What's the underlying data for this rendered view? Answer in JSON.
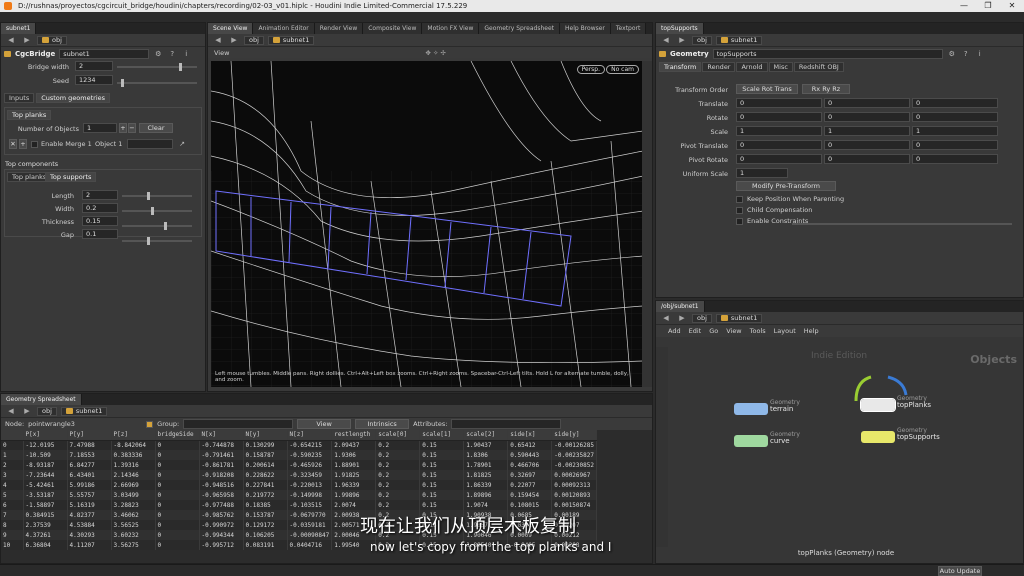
{
  "window": {
    "title": "D://rushnas/proyectos/cgcircuit_bridge/houdini/chapters/recording/02-03_v01.hiplc - Houdini Indie Limited-Commercial 17.5.229",
    "controls": [
      "—",
      "❐",
      "✕"
    ]
  },
  "left_panel": {
    "tab": "subnet1",
    "path": "obj",
    "node_type": "CgcBridge",
    "node_name": "subnet1",
    "params": [
      {
        "label": "Bridge width",
        "value": "2",
        "level": 0.78
      },
      {
        "label": "Seed",
        "value": "1234",
        "level": 0.05
      }
    ],
    "tabs": [
      "Inputs",
      "Custom geometries"
    ],
    "group_tab": "Top planks",
    "num_objects_label": "Number of Objects",
    "num_objects_value": "1",
    "plus": "+",
    "minus": "−",
    "clear_label": "Clear",
    "enable_merge_label": "Enable Merge 1",
    "object1_label": "Object 1",
    "top_components": "Top components",
    "comp_tabs": [
      "Top planks",
      "Top supports"
    ],
    "comp_params": [
      {
        "label": "Length",
        "value": "2",
        "level": 0.35
      },
      {
        "label": "Width",
        "value": "0.2",
        "level": 0.42
      },
      {
        "label": "Thickness",
        "value": "0.15",
        "level": 0.6
      },
      {
        "label": "Gap",
        "value": "0.1",
        "level": 0.35
      }
    ]
  },
  "center_tabs": [
    "Scene View",
    "Animation Editor",
    "Render View",
    "Composite View",
    "Motion FX View",
    "Geometry Spreadsheet",
    "Help Browser",
    "Textport"
  ],
  "viewport": {
    "path": "obj",
    "crumb": "subnet1",
    "label": "View",
    "persp": "Persp.",
    "cam": "No cam",
    "status": "Left mouse tumbles. Middle pans. Right dollies. Ctrl+Alt+Left box zooms. Ctrl+Right zooms. Spacebar-Ctrl-Left tilts. Hold L for alternate tumble, dolly, and zoom."
  },
  "params_panel": {
    "tab": "topSupports",
    "path": "obj",
    "crumb": "subnet1",
    "node_type": "Geometry",
    "node_name": "topSupports",
    "tabs": [
      "Transform",
      "Render",
      "Arnold",
      "Misc",
      "Redshift OBJ"
    ],
    "transform_order_label": "Transform Order",
    "transform_order": "Scale Rot Trans",
    "rot_order": "Rx Ry Rz",
    "rows": [
      {
        "label": "Translate",
        "v": [
          "0",
          "0",
          "0"
        ]
      },
      {
        "label": "Rotate",
        "v": [
          "0",
          "0",
          "0"
        ]
      },
      {
        "label": "Scale",
        "v": [
          "1",
          "1",
          "1"
        ]
      },
      {
        "label": "Pivot Translate",
        "v": [
          "0",
          "0",
          "0"
        ]
      },
      {
        "label": "Pivot Rotate",
        "v": [
          "0",
          "0",
          "0"
        ]
      }
    ],
    "uniform_scale_label": "Uniform Scale",
    "uniform_scale": "1",
    "modify_pre": "Modify Pre-Transform",
    "checks": [
      "Keep Position When Parenting",
      "Child Compensation",
      "Enable Constraints"
    ]
  },
  "network": {
    "tab": "/obj/subnet1",
    "path": "obj",
    "crumb": "subnet1",
    "menu": [
      "Add",
      "Edit",
      "Go",
      "View",
      "Tools",
      "Layout",
      "Help"
    ],
    "watermark": "Indie Edition",
    "context": "Objects",
    "nodes": [
      {
        "type": "Geometry",
        "name": "terrain",
        "color": "#8fb8e8"
      },
      {
        "type": "Geometry",
        "name": "topPlanks",
        "color": "#e8e8e8"
      },
      {
        "type": "Geometry",
        "name": "curve",
        "color": "#9fd89f"
      },
      {
        "type": "Geometry",
        "name": "topSupports",
        "color": "#e8e86a"
      }
    ],
    "footer": "topPlanks (Geometry) node"
  },
  "spreadsheet": {
    "tab": "Geometry Spreadsheet",
    "path": "obj",
    "crumb": "subnet1",
    "node_label": "Node:",
    "node": "pointwrangle3",
    "group_label": "Group:",
    "view": "View",
    "intrinsics": "Intrinsics",
    "attributes": "Attributes:",
    "columns": [
      "",
      "P[x]",
      "P[y]",
      "P[z]",
      "bridgeSide",
      "N[x]",
      "N[y]",
      "N[z]",
      "restlength",
      "scale[0]",
      "scale[1]",
      "scale[2]",
      "side[x]",
      "side[y]"
    ],
    "rows": [
      [
        "0",
        "-12.0195",
        "7.47988",
        "-8.842064",
        "0",
        "-0.744878",
        "0.130299",
        "-0.654215",
        "2.09437",
        "0.2",
        "0.15",
        "1.90437",
        "0.65412",
        "-0.00126285"
      ],
      [
        "1",
        "-10.509",
        "7.18553",
        "0.383336",
        "0",
        "-0.791461",
        "0.158787",
        "-0.590235",
        "1.9306",
        "0.2",
        "0.15",
        "1.8306",
        "0.590443",
        "-0.00235827"
      ],
      [
        "2",
        "-8.93187",
        "6.84277",
        "1.39316",
        "0",
        "-0.861781",
        "0.200614",
        "-0.465926",
        "1.88901",
        "0.2",
        "0.15",
        "1.78901",
        "0.466706",
        "-0.00230852"
      ],
      [
        "3",
        "-7.23644",
        "6.43401",
        "2.14346",
        "0",
        "-0.918208",
        "0.228622",
        "-0.323459",
        "1.91825",
        "0.2",
        "0.15",
        "1.81825",
        "0.32697",
        "0.00026967"
      ],
      [
        "4",
        "-5.42461",
        "5.99186",
        "2.66969",
        "0",
        "-0.948516",
        "0.227841",
        "-0.220013",
        "1.96339",
        "0.2",
        "0.15",
        "1.86339",
        "0.22077",
        "0.00092313"
      ],
      [
        "5",
        "-3.53187",
        "5.55757",
        "3.03499",
        "0",
        "-0.965958",
        "0.219772",
        "-0.149998",
        "1.99896",
        "0.2",
        "0.15",
        "1.89896",
        "0.159454",
        "0.00120893"
      ],
      [
        "6",
        "-1.58897",
        "5.16319",
        "3.28823",
        "0",
        "-0.977488",
        "0.18385",
        "-0.103515",
        "2.0074",
        "0.2",
        "0.15",
        "1.9074",
        "0.108015",
        "0.00150874"
      ],
      [
        "7",
        "0.384915",
        "4.82377",
        "3.46062",
        "0",
        "-0.985762",
        "0.153787",
        "-0.0679770",
        "2.00938",
        "0.2",
        "0.15",
        "1.90938",
        "0.0685",
        "0.00189"
      ],
      [
        "8",
        "2.37539",
        "4.53884",
        "3.56525",
        "0",
        "-0.990972",
        "0.129172",
        "-0.0359181",
        "2.00571",
        "0.2",
        "0.15",
        "1.90571",
        "0.0361",
        "0.00207"
      ],
      [
        "9",
        "4.37261",
        "4.30293",
        "3.60232",
        "0",
        "-0.994344",
        "0.106205",
        "-0.00090847",
        "2.00046",
        "0.2",
        "0.15",
        "1.90046",
        "0.0009",
        "0.00212"
      ],
      [
        "10",
        "6.36804",
        "4.11207",
        "3.56275",
        "0",
        "-0.995712",
        "0.083191",
        "0.0404716",
        "1.99540",
        "0.2",
        "0.15",
        "1.89540",
        "-0.0405",
        "0.00208"
      ]
    ]
  },
  "subtitles": {
    "cn": "现在让我们从顶层木板复制",
    "en": "now let's copy from the top planks and I"
  },
  "auto_update": "Auto Update"
}
